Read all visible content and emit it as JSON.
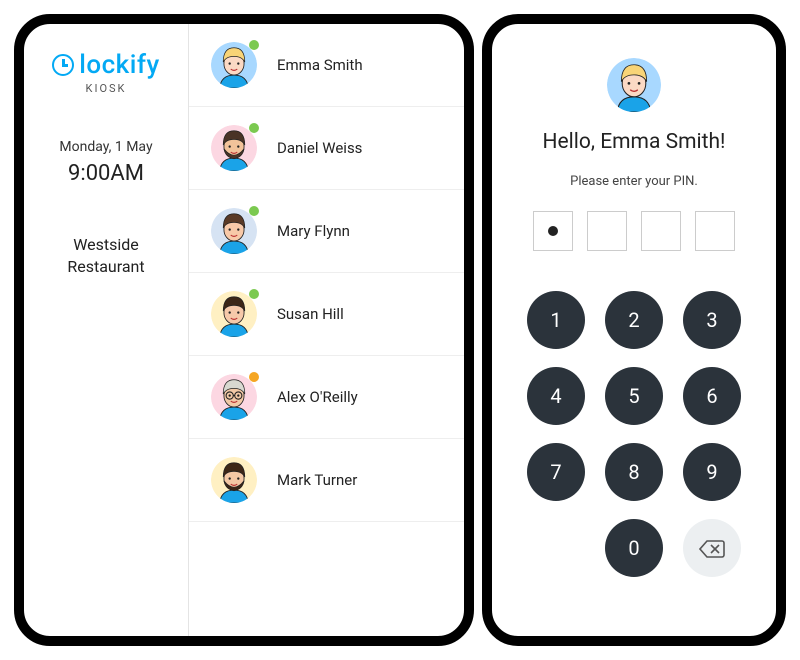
{
  "brand": {
    "name": "lockify",
    "subtitle": "KIOSK"
  },
  "date": "Monday, 1 May",
  "time": "9:00AM",
  "location_line1": "Westside",
  "location_line2": "Restaurant",
  "users": [
    {
      "name": "Emma Smith",
      "bg": "#a8d8ff",
      "status": "green",
      "hair": "#f8d477",
      "skin": "#fbd9c4",
      "shirt": "#1aa3e8",
      "beard": false
    },
    {
      "name": "Daniel Weiss",
      "bg": "#fcd7e2",
      "status": "green",
      "hair": "#4a3326",
      "skin": "#f2c39a",
      "shirt": "#1aa3e8",
      "beard": true
    },
    {
      "name": "Mary Flynn",
      "bg": "#d6e3f3",
      "status": "green",
      "hair": "#5a3a26",
      "skin": "#f8c9a8",
      "shirt": "#1aa3e8",
      "beard": false
    },
    {
      "name": "Susan Hill",
      "bg": "#fff0c3",
      "status": "green",
      "hair": "#3c2617",
      "skin": "#f6c9aa",
      "shirt": "#1aa3e8",
      "beard": false
    },
    {
      "name": "Alex O'Reilly",
      "bg": "#fcd7e2",
      "status": "orange",
      "hair": "#d8d8d0",
      "skin": "#f2c9a6",
      "shirt": "#1aa3e8",
      "beard": false,
      "glasses": true
    },
    {
      "name": "Mark Turner",
      "bg": "#fff0c3",
      "status": "none",
      "hair": "#3c2617",
      "skin": "#f4c8a5",
      "shirt": "#1aa3e8",
      "beard": true
    }
  ],
  "pin": {
    "greeting": "Hello, Emma Smith!",
    "prompt": "Please enter your PIN.",
    "filled_count": 1,
    "total": 4,
    "avatar": {
      "bg": "#a8d8ff",
      "hair": "#f8d477",
      "skin": "#fbd9c4",
      "shirt": "#1aa3e8",
      "beard": false
    }
  },
  "keypad": [
    "1",
    "2",
    "3",
    "4",
    "5",
    "6",
    "7",
    "8",
    "9",
    "",
    "0",
    "back"
  ],
  "colors": {
    "status_green": "#7bc950",
    "status_orange": "#f5a623",
    "brand_blue": "#03A9F4",
    "key_bg": "#2b333b"
  }
}
